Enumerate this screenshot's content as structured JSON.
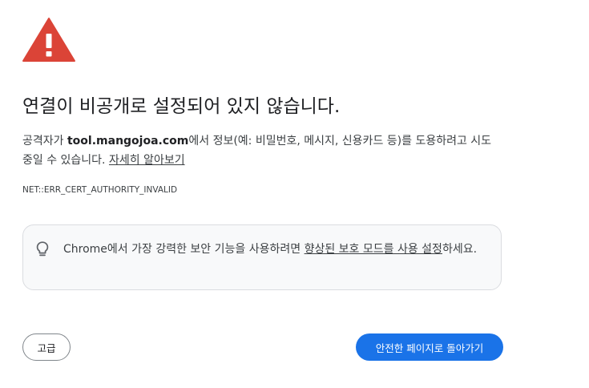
{
  "interstitial": {
    "title": "연결이 비공개로 설정되어 있지 않습니다.",
    "description_prefix": "공격자가 ",
    "domain": "tool.mangojoa.com",
    "description_suffix": "에서 정보(예: 비밀번호, 메시지, 신용카드 등)를 도용하려고 시도 중일 수 있습니다. ",
    "learn_more_label": "자세히 알아보기",
    "error_code": "NET::ERR_CERT_AUTHORITY_INVALID",
    "icon": "warning-triangle-icon",
    "warning_color": "#db4437"
  },
  "enhanced_protection": {
    "icon": "lightbulb-icon",
    "text_prefix": "Chrome에서 가장 강력한 보안 기능을 사용하려면 ",
    "link_label": "향상된 보호 모드를 사용 설정",
    "text_suffix": "하세요."
  },
  "buttons": {
    "advanced_label": "고급",
    "back_to_safety_label": "안전한 페이지로 돌아가기",
    "primary_color": "#1a73e8"
  }
}
